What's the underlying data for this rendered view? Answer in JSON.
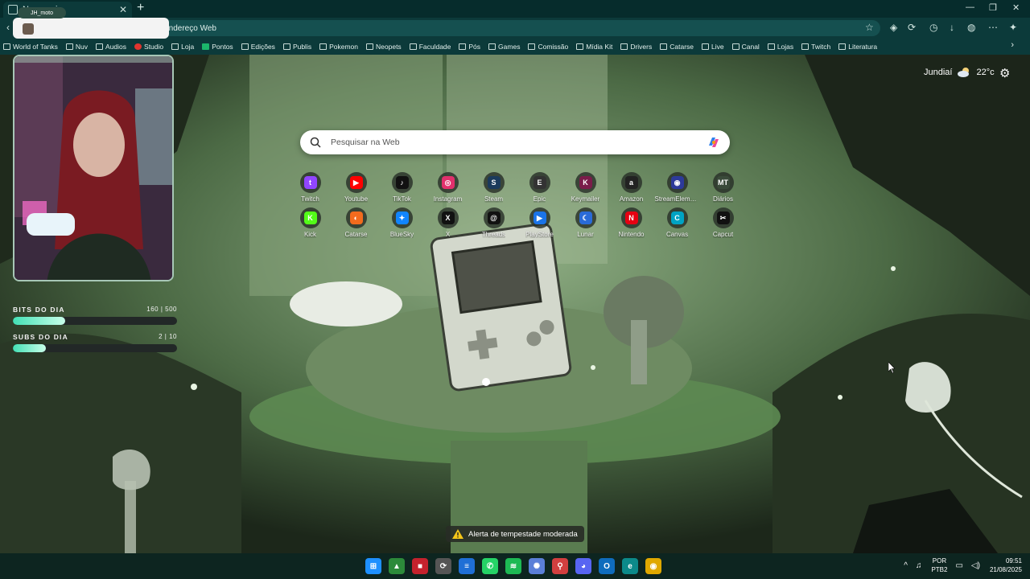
{
  "browser": {
    "tab_title": "Nova guia",
    "new_tab": "+",
    "address_placeholder": "r endereço Web"
  },
  "bookmarks": [
    "World of Tanks",
    "Nuv",
    "Audios",
    "Studio",
    "Loja",
    "Pontos",
    "Edições",
    "Publis",
    "Pokemon",
    "Neopets",
    "Faculdade",
    "Pós",
    "Games",
    "Comissão",
    "Mídia Kit",
    "Drivers",
    "Catarse",
    "Live",
    "Canal",
    "Lojas",
    "Twitch",
    "Literatura"
  ],
  "overlay": {
    "username": "JH_moto",
    "bits_label": "BITS DO DIA",
    "bits_value": "160 | 500",
    "bits_progress": 0.32,
    "subs_label": "SUBS DO DIA",
    "subs_value": "2 | 10",
    "subs_progress": 0.2
  },
  "weather": {
    "city": "Jundiaí",
    "temp": "22°c"
  },
  "search": {
    "placeholder": "Pesquisar na Web"
  },
  "quick_links": [
    {
      "label": "Twitch",
      "color": "#9146ff",
      "glyph": "t"
    },
    {
      "label": "Youtube",
      "color": "#ff0000",
      "glyph": "▶"
    },
    {
      "label": "TikTok",
      "color": "#111111",
      "glyph": "♪"
    },
    {
      "label": "Instagram",
      "color": "#e1306c",
      "glyph": "◎"
    },
    {
      "label": "Steam",
      "color": "#1b3a5c",
      "glyph": "S"
    },
    {
      "label": "Epic",
      "color": "#333333",
      "glyph": "E"
    },
    {
      "label": "Keymailer",
      "color": "#7a1d4a",
      "glyph": "K"
    },
    {
      "label": "Amazon",
      "color": "#222222",
      "glyph": "a"
    },
    {
      "label": "StreamElements",
      "color": "#2d3a9a",
      "glyph": "◉"
    },
    {
      "label": "Diários",
      "color": "#3a4a3a",
      "glyph": "MT"
    },
    {
      "label": "Kick",
      "color": "#53fc18",
      "glyph": "K"
    },
    {
      "label": "Catarse",
      "color": "#f26b1d",
      "glyph": "◐"
    },
    {
      "label": "BlueSky",
      "color": "#1185fe",
      "glyph": "✦"
    },
    {
      "label": "X",
      "color": "#111111",
      "glyph": "X"
    },
    {
      "label": "Threads",
      "color": "#111111",
      "glyph": "@"
    },
    {
      "label": "PlayStore",
      "color": "#1a73e8",
      "glyph": "▶"
    },
    {
      "label": "Lunar",
      "color": "#2a6bd8",
      "glyph": "☾"
    },
    {
      "label": "Nintendo",
      "color": "#e60012",
      "glyph": "N"
    },
    {
      "label": "Canvas",
      "color": "#00a3c4",
      "glyph": "C"
    },
    {
      "label": "Capcut",
      "color": "#111111",
      "glyph": "✂"
    }
  ],
  "alert": {
    "text": "Alerta de tempestade moderada"
  },
  "taskbar": {
    "language": "POR",
    "keyboard": "PTB2",
    "time": "09:51",
    "date": "21/08/2025",
    "apps": [
      {
        "name": "windows",
        "color": "#1e90ff",
        "glyph": "⊞"
      },
      {
        "name": "app-green",
        "color": "#2c8a3a",
        "glyph": "▲"
      },
      {
        "name": "app-red",
        "color": "#c4222d",
        "glyph": "■"
      },
      {
        "name": "app-cycle",
        "color": "#555555",
        "glyph": "⟳"
      },
      {
        "name": "notes",
        "color": "#1f6fd6",
        "glyph": "≡"
      },
      {
        "name": "whatsapp",
        "color": "#25d366",
        "glyph": "✆"
      },
      {
        "name": "spotify",
        "color": "#1db954",
        "glyph": "≋"
      },
      {
        "name": "shell",
        "color": "#5a7fd8",
        "glyph": "✺"
      },
      {
        "name": "maps",
        "color": "#d23f3f",
        "glyph": "⚲"
      },
      {
        "name": "discord",
        "color": "#5865f2",
        "glyph": "◕"
      },
      {
        "name": "outlook",
        "color": "#0f6cbd",
        "glyph": "O"
      },
      {
        "name": "edge",
        "color": "#0c8a8a",
        "glyph": "e"
      },
      {
        "name": "chrome",
        "color": "#e0a800",
        "glyph": "◉"
      }
    ]
  }
}
